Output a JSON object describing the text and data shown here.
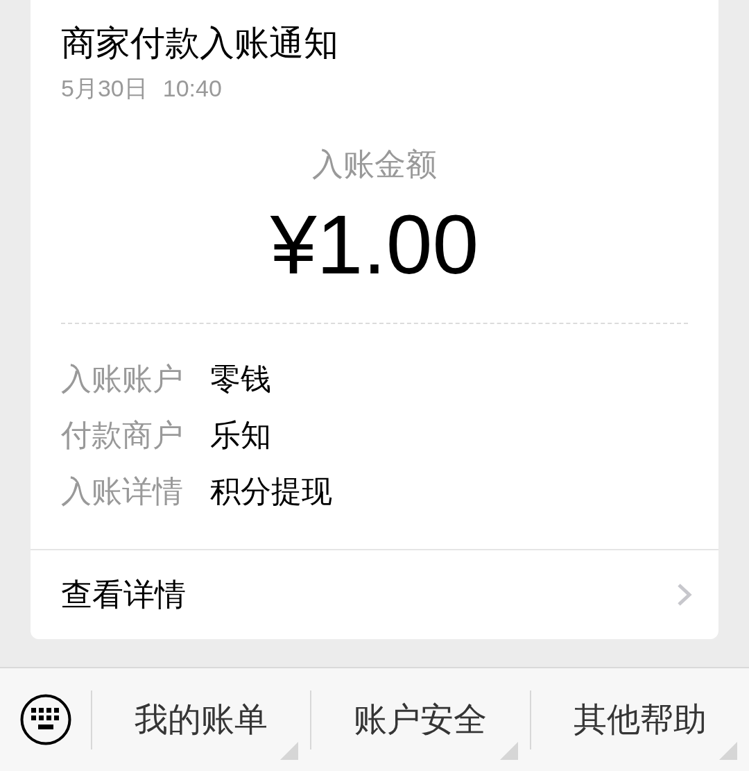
{
  "notification": {
    "title": "商家付款入账通知",
    "date": "5月30日",
    "time": "10:40",
    "amount_label": "入账金额",
    "amount": "¥1.00",
    "details": [
      {
        "label": "入账账户",
        "value": "零钱"
      },
      {
        "label": "付款商户",
        "value": "乐知"
      },
      {
        "label": "入账详情",
        "value": "积分提现"
      }
    ],
    "link": "查看详情"
  },
  "menu_bar": {
    "items": [
      "我的账单",
      "账户安全",
      "其他帮助"
    ]
  }
}
